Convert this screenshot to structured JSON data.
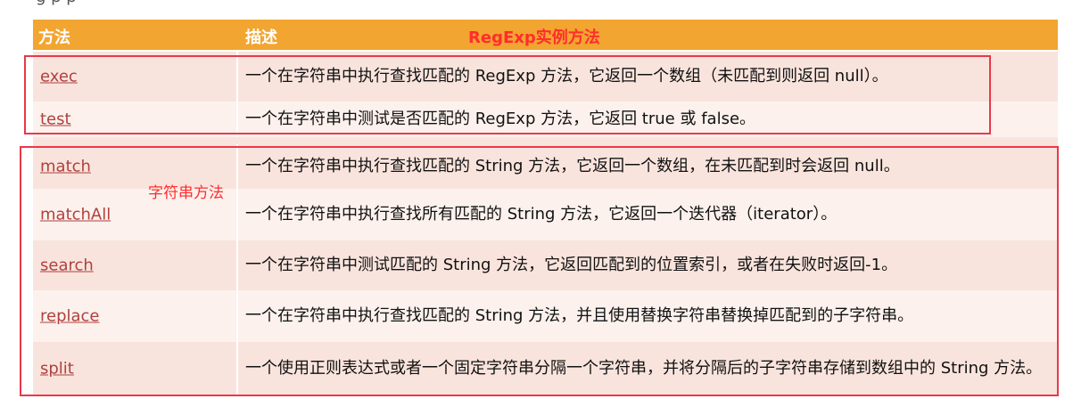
{
  "top_text": "g                                        p                p",
  "header": {
    "method": "方法",
    "description": "描述",
    "title": "RegExp实例方法"
  },
  "string_label": "字符串方法",
  "rows": [
    {
      "method": "exec",
      "desc": "一个在字符串中执行查找匹配的 RegExp 方法，它返回一个数组（未匹配到则返回 null）。"
    },
    {
      "method": "test",
      "desc": "一个在字符串中测试是否匹配的 RegExp 方法，它返回 true 或 false。"
    },
    {
      "method": "match",
      "desc": "一个在字符串中执行查找匹配的 String 方法，它返回一个数组，在未匹配到时会返回 null。"
    },
    {
      "method": "matchAll",
      "desc": "一个在字符串中执行查找所有匹配的 String 方法，它返回一个迭代器（iterator）。"
    },
    {
      "method": "search",
      "desc": "一个在字符串中测试匹配的 String 方法，它返回匹配到的位置索引，或者在失败时返回-1。"
    },
    {
      "method": "replace",
      "desc": "一个在字符串中执行查找匹配的 String 方法，并且使用替换字符串替换掉匹配到的子字符串。"
    },
    {
      "method": "split",
      "desc": "一个使用正则表达式或者一个固定字符串分隔一个字符串，并将分隔后的子字符串存储到数组中的 String 方法。"
    }
  ]
}
